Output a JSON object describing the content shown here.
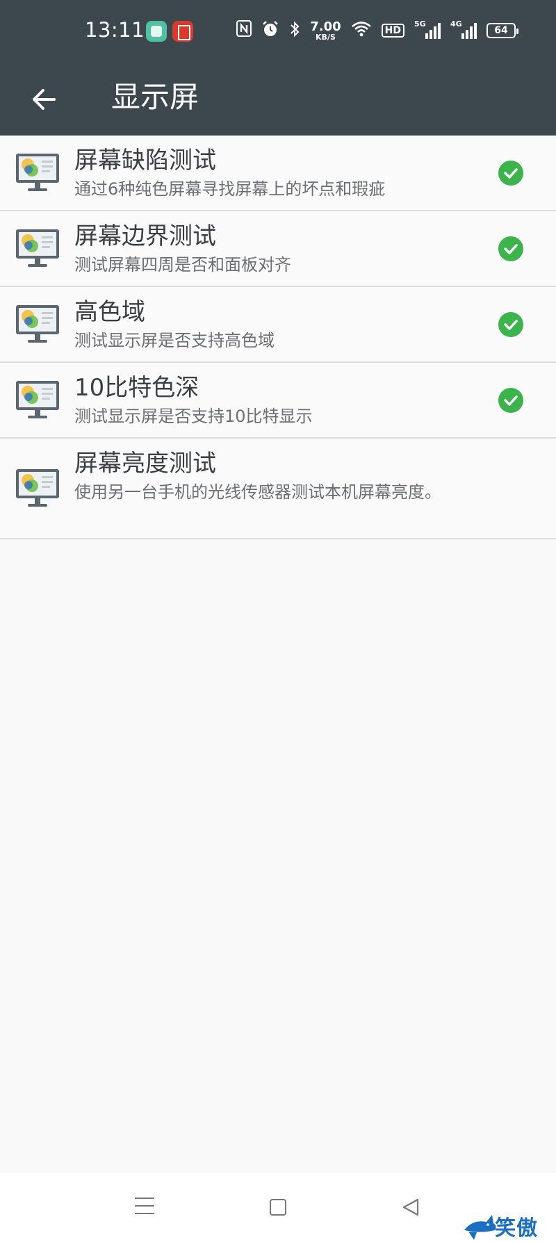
{
  "status_bar": {
    "time": "13:11",
    "speed_value": "7.00",
    "speed_unit": "KB/S",
    "hd_label": "HD",
    "net1": "5G",
    "net2": "4G",
    "battery": "64",
    "icons": [
      "nfc-icon",
      "alarm-icon",
      "bluetooth-icon",
      "wifi-icon"
    ]
  },
  "app_bar": {
    "title": "显示屏",
    "back_icon": "arrow-left-icon"
  },
  "items": [
    {
      "title": "屏幕缺陷测试",
      "desc": "通过6种纯色屏幕寻找屏幕上的坏点和瑕疵",
      "checked": true
    },
    {
      "title": "屏幕边界测试",
      "desc": "测试屏幕四周是否和面板对齐",
      "checked": true
    },
    {
      "title": "高色域",
      "desc": "测试显示屏是否支持高色域",
      "checked": true
    },
    {
      "title": "10比特色深",
      "desc": "测试显示屏是否支持10比特显示",
      "checked": true
    },
    {
      "title": "屏幕亮度测试",
      "desc": "使用另一台手机的光线传感器测试本机屏幕亮度。",
      "checked": false
    }
  ],
  "nav_bar": {
    "icons": [
      "menu-icon",
      "home-icon",
      "back-icon"
    ]
  },
  "watermark": {
    "text": "笑傲网"
  },
  "colors": {
    "bar": "#3c474e",
    "check": "#3cb44c",
    "background": "#f9f9f9"
  }
}
